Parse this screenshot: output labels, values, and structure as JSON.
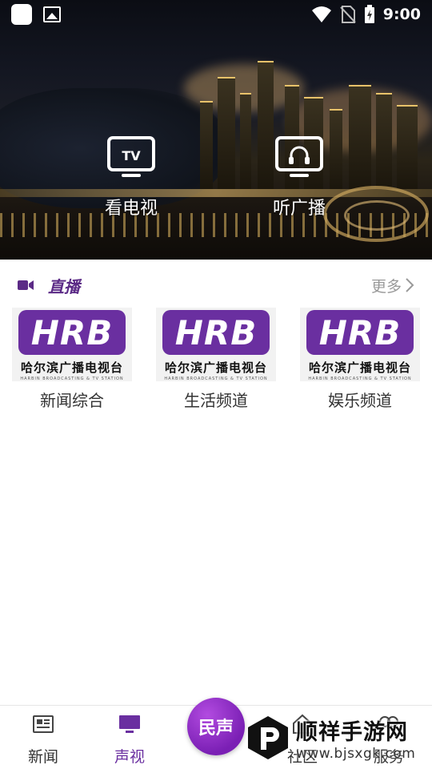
{
  "status_bar": {
    "time": "9:00"
  },
  "hero": {
    "buttons": [
      {
        "label": "看电视",
        "icon": "tv-icon",
        "icon_text": "TV"
      },
      {
        "label": "听广播",
        "icon": "headphones-icon"
      }
    ]
  },
  "live_section": {
    "title": "直播",
    "icon": "video-camera-icon",
    "more_label": "更多",
    "channels": [
      {
        "name": "新闻综合",
        "logo_text": "HRB",
        "logo_caption": "哈尔滨广播电视台",
        "logo_sub": "HARBIN BROADCASTING & TV STATION"
      },
      {
        "name": "生活频道",
        "logo_text": "HRB",
        "logo_caption": "哈尔滨广播电视台",
        "logo_sub": "HARBIN BROADCASTING & TV STATION"
      },
      {
        "name": "娱乐频道",
        "logo_text": "HRB",
        "logo_caption": "哈尔滨广播电视台",
        "logo_sub": "HARBIN BROADCASTING & TV STATION"
      }
    ]
  },
  "bottom_nav": {
    "items": [
      {
        "label": "新闻",
        "icon": "newspaper-icon",
        "active": false
      },
      {
        "label": "声视",
        "icon": "monitor-icon",
        "active": true
      },
      {
        "label": "社区",
        "icon": "home-icon",
        "active": false
      },
      {
        "label": "服务",
        "icon": "service-icon",
        "active": false
      }
    ],
    "center_label": "民声"
  },
  "watermark": {
    "title": "顺祥手游网",
    "url": "www.bjsxgk.com"
  },
  "colors": {
    "accent": "#6a2fa0",
    "more_text": "#999999"
  }
}
